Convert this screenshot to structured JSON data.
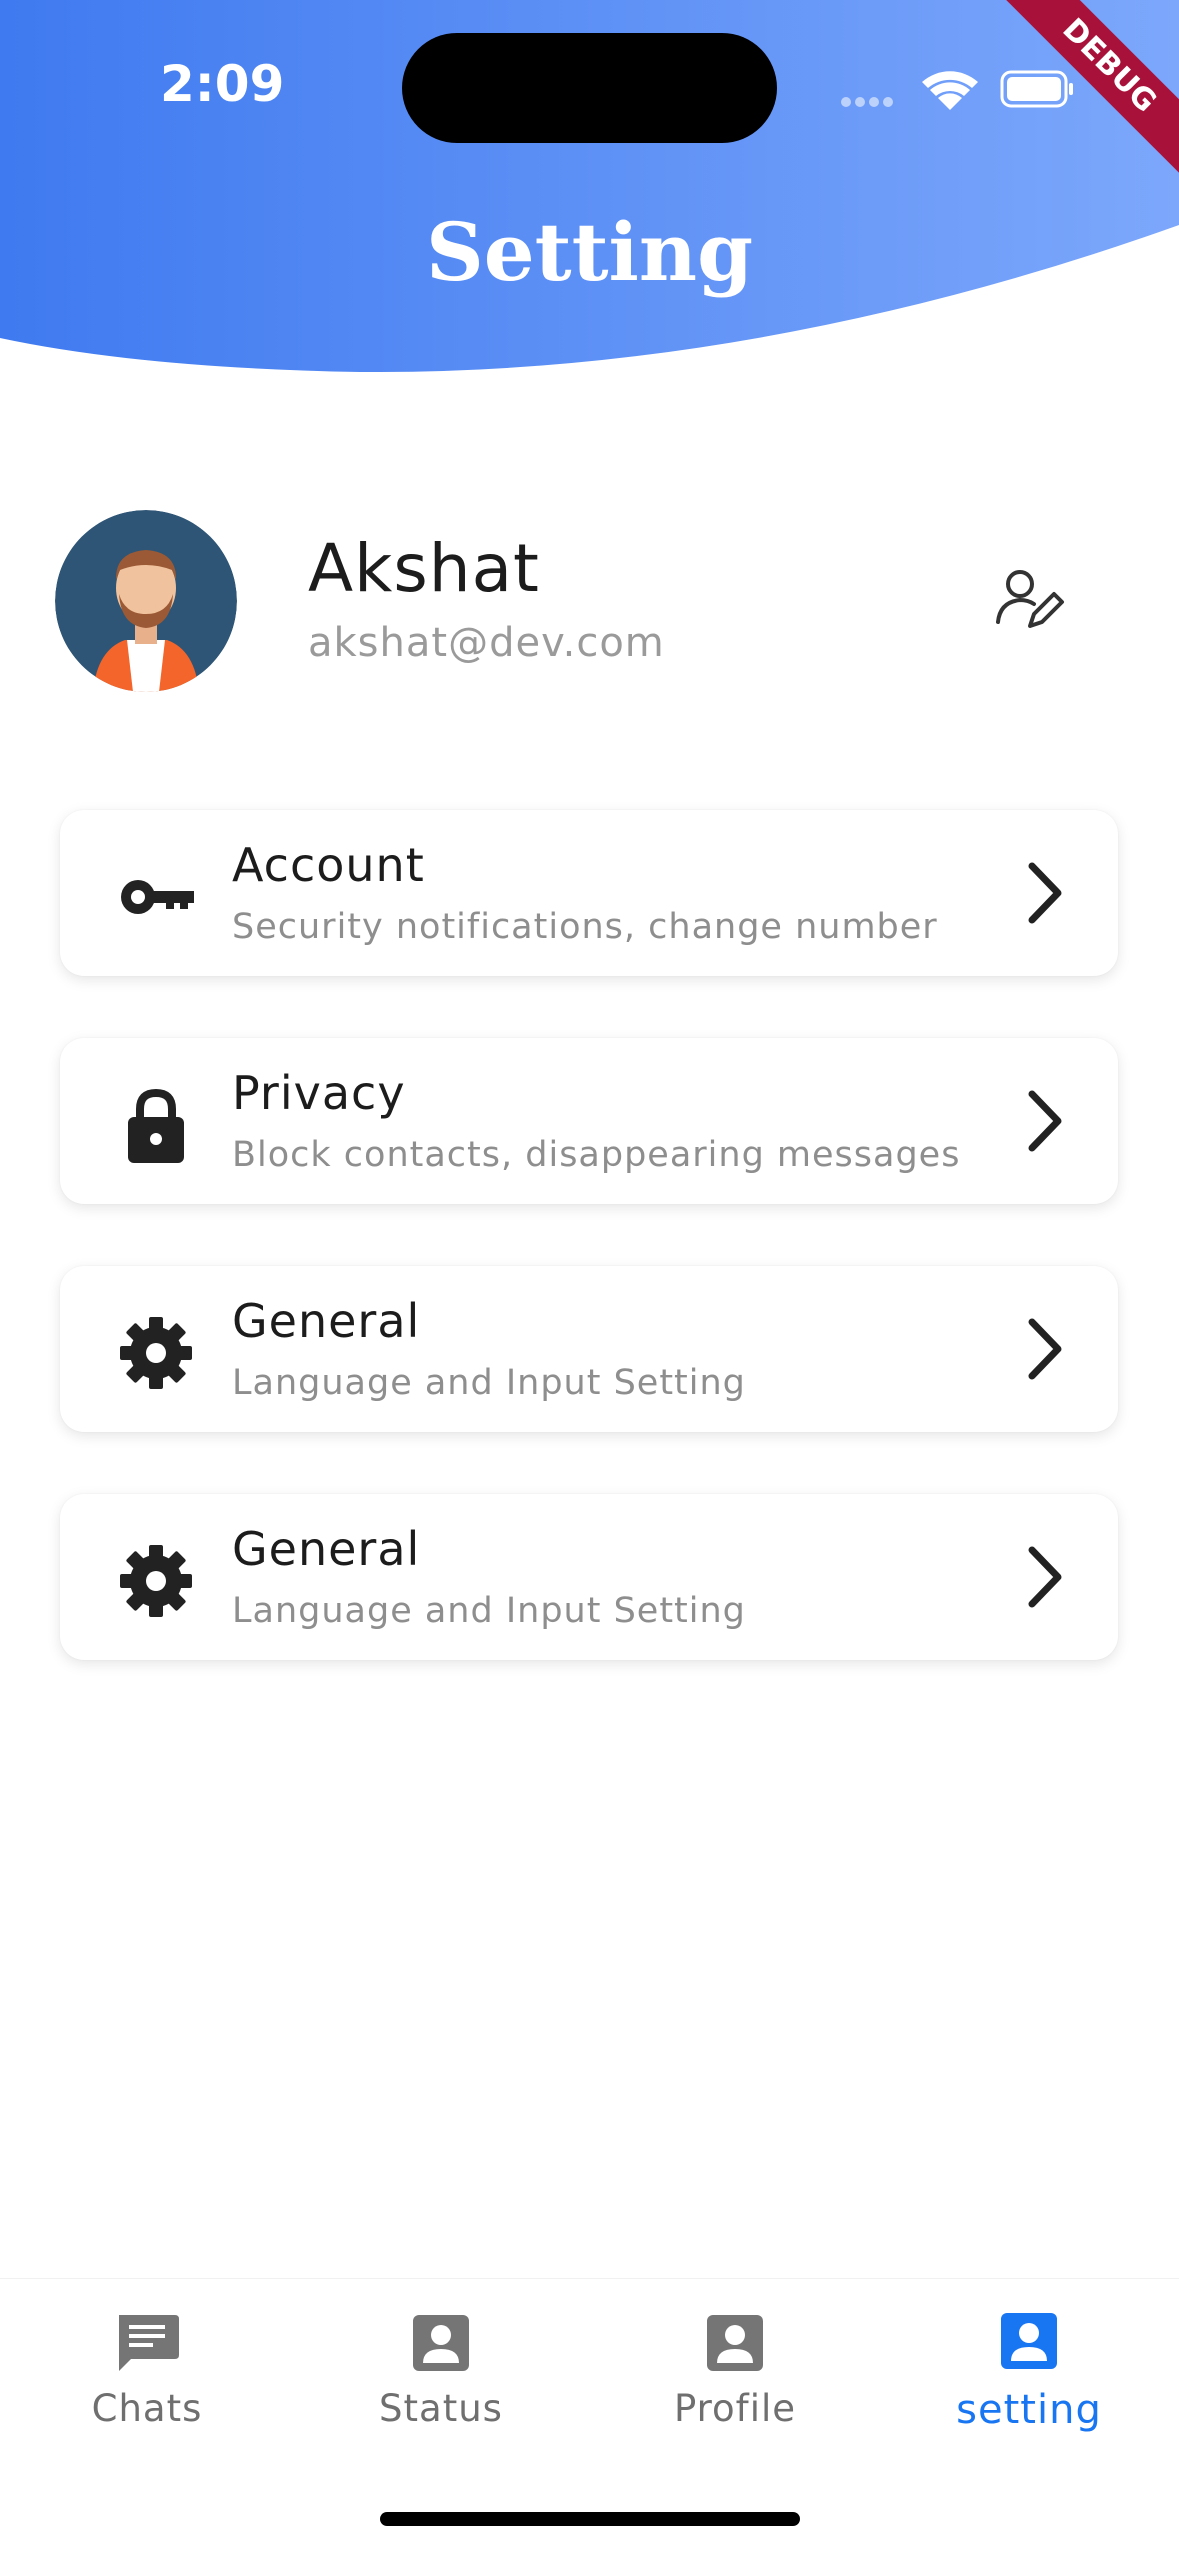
{
  "status_bar": {
    "time": "2:09",
    "debug_label": "DEBUG"
  },
  "header": {
    "title": "Setting",
    "gradient_start": "#3f7af0",
    "gradient_end": "#7ca7fb"
  },
  "profile": {
    "name": "Akshat",
    "email": "akshat@dev.com",
    "edit_icon": "edit-profile-icon"
  },
  "settings_items": [
    {
      "icon": "key-icon",
      "title": "Account",
      "subtitle": "Security notifications, change number"
    },
    {
      "icon": "lock-icon",
      "title": "Privacy",
      "subtitle": "Block contacts, disappearing messages"
    },
    {
      "icon": "gear-icon",
      "title": "General",
      "subtitle": "Language and Input Setting"
    },
    {
      "icon": "gear-icon",
      "title": "General",
      "subtitle": "Language and Input Setting"
    }
  ],
  "bottom_nav": {
    "items": [
      {
        "label": "Chats",
        "icon": "chat-icon",
        "active": false
      },
      {
        "label": "Status",
        "icon": "contact-icon",
        "active": false
      },
      {
        "label": "Profile",
        "icon": "contact-icon",
        "active": false
      },
      {
        "label": "setting",
        "icon": "contact-icon",
        "active": true
      }
    ],
    "active_color": "#1976f2",
    "inactive_color": "#6f6f6f"
  }
}
